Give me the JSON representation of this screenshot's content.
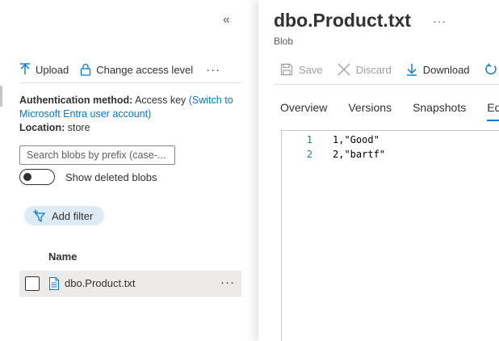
{
  "left_pane": {
    "collapse_glyph": "«",
    "toolbar": {
      "upload_label": "Upload",
      "change_access_label": "Change access level",
      "more_glyph": "···"
    },
    "auth": {
      "method_label": "Authentication method:",
      "method_value": "Access key",
      "switch_link": "(Switch to Microsoft Entra user account)",
      "location_label": "Location:",
      "location_value": "store"
    },
    "search": {
      "placeholder": "Search blobs by prefix (case-..."
    },
    "show_deleted": {
      "label": "Show deleted blobs",
      "on": false
    },
    "add_filter_label": "Add filter",
    "list": {
      "column_name": "Name",
      "rows": [
        {
          "name": "dbo.Product.txt",
          "more_glyph": "···"
        }
      ]
    }
  },
  "right_pane": {
    "title": "dbo.Product.txt",
    "title_more_glyph": "···",
    "subtitle": "Blob",
    "toolbar": {
      "save_label": "Save",
      "discard_label": "Discard",
      "download_label": "Download"
    },
    "tabs": [
      {
        "label": "Overview"
      },
      {
        "label": "Versions"
      },
      {
        "label": "Snapshots"
      },
      {
        "label": "Edit"
      }
    ],
    "editor": {
      "lines": [
        {
          "number": "1",
          "text": "1,\"Good\""
        },
        {
          "number": "2",
          "text": "2,\"bartf\""
        }
      ]
    }
  },
  "colors": {
    "accent": "#0078d4",
    "chip_bg": "#ddebf7",
    "selected_row_bg": "#edebe9",
    "line_number": "#237893"
  },
  "icons": {
    "upload": "upload-icon",
    "change_access": "lock-icon",
    "save": "save-icon",
    "discard": "close-icon",
    "download": "download-icon",
    "refresh": "refresh-icon",
    "add_filter": "filter-add-icon",
    "file": "file-icon"
  }
}
